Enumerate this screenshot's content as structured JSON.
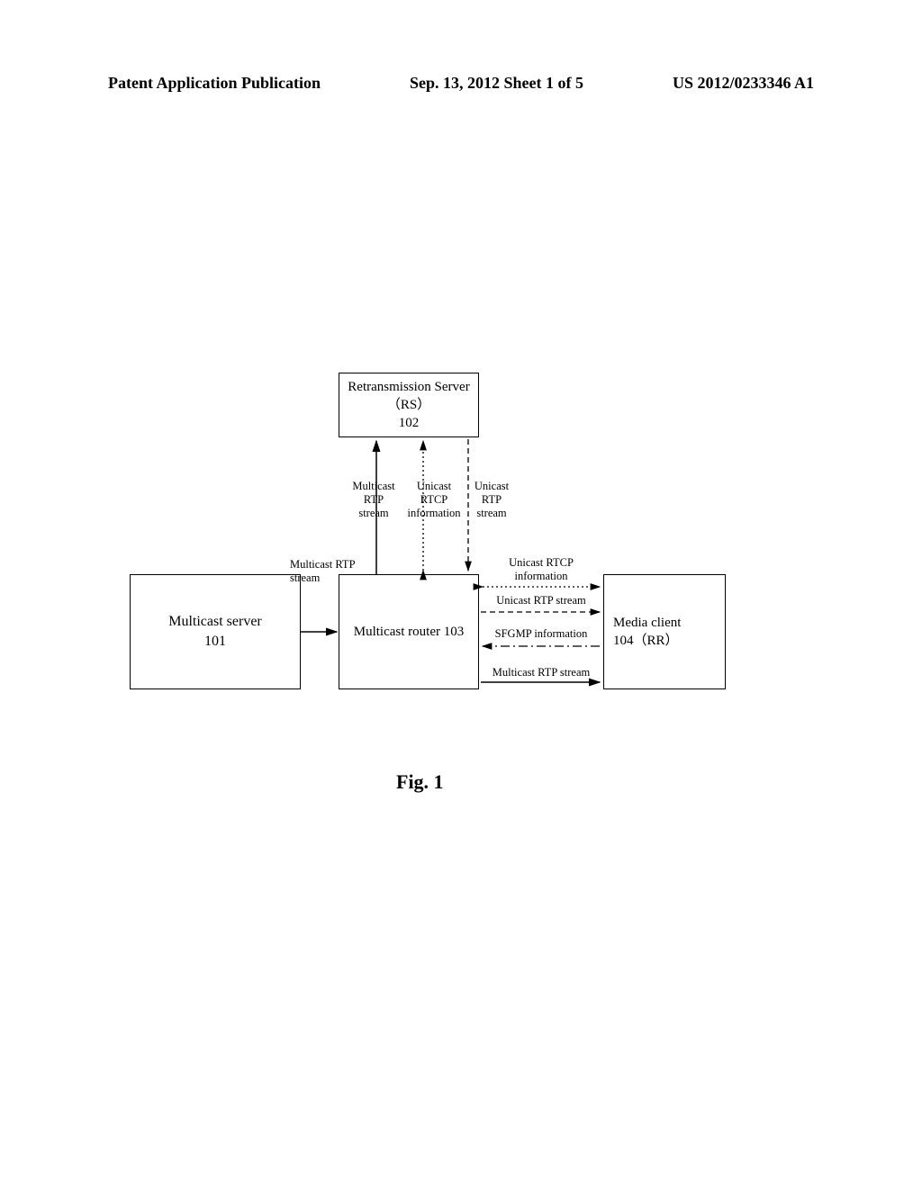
{
  "header": {
    "left": "Patent Application Publication",
    "center": "Sep. 13, 2012  Sheet 1 of 5",
    "right": "US 2012/0233346 A1"
  },
  "boxes": {
    "rs": {
      "line1": "Retransmission Server",
      "line2": "（RS）",
      "num": "102"
    },
    "ms": {
      "line1": "Multicast server",
      "num": "101"
    },
    "mr": {
      "line1": "Multicast router 103"
    },
    "mc": {
      "line1": "Media client",
      "line2": "104（RR）"
    }
  },
  "labels": {
    "ms_to_mr": "Multicast RTP\nstream",
    "rs_left": "Multicast\nRTP\nstream",
    "rs_mid": "Unicast\nRTCP\ninformation",
    "rs_right": "Unicast\nRTP\nstream",
    "right1": "Unicast RTCP\ninformation",
    "right2": "Unicast RTP stream",
    "right3": "SFGMP information",
    "right4": "Multicast RTP stream"
  },
  "caption": "Fig. 1"
}
